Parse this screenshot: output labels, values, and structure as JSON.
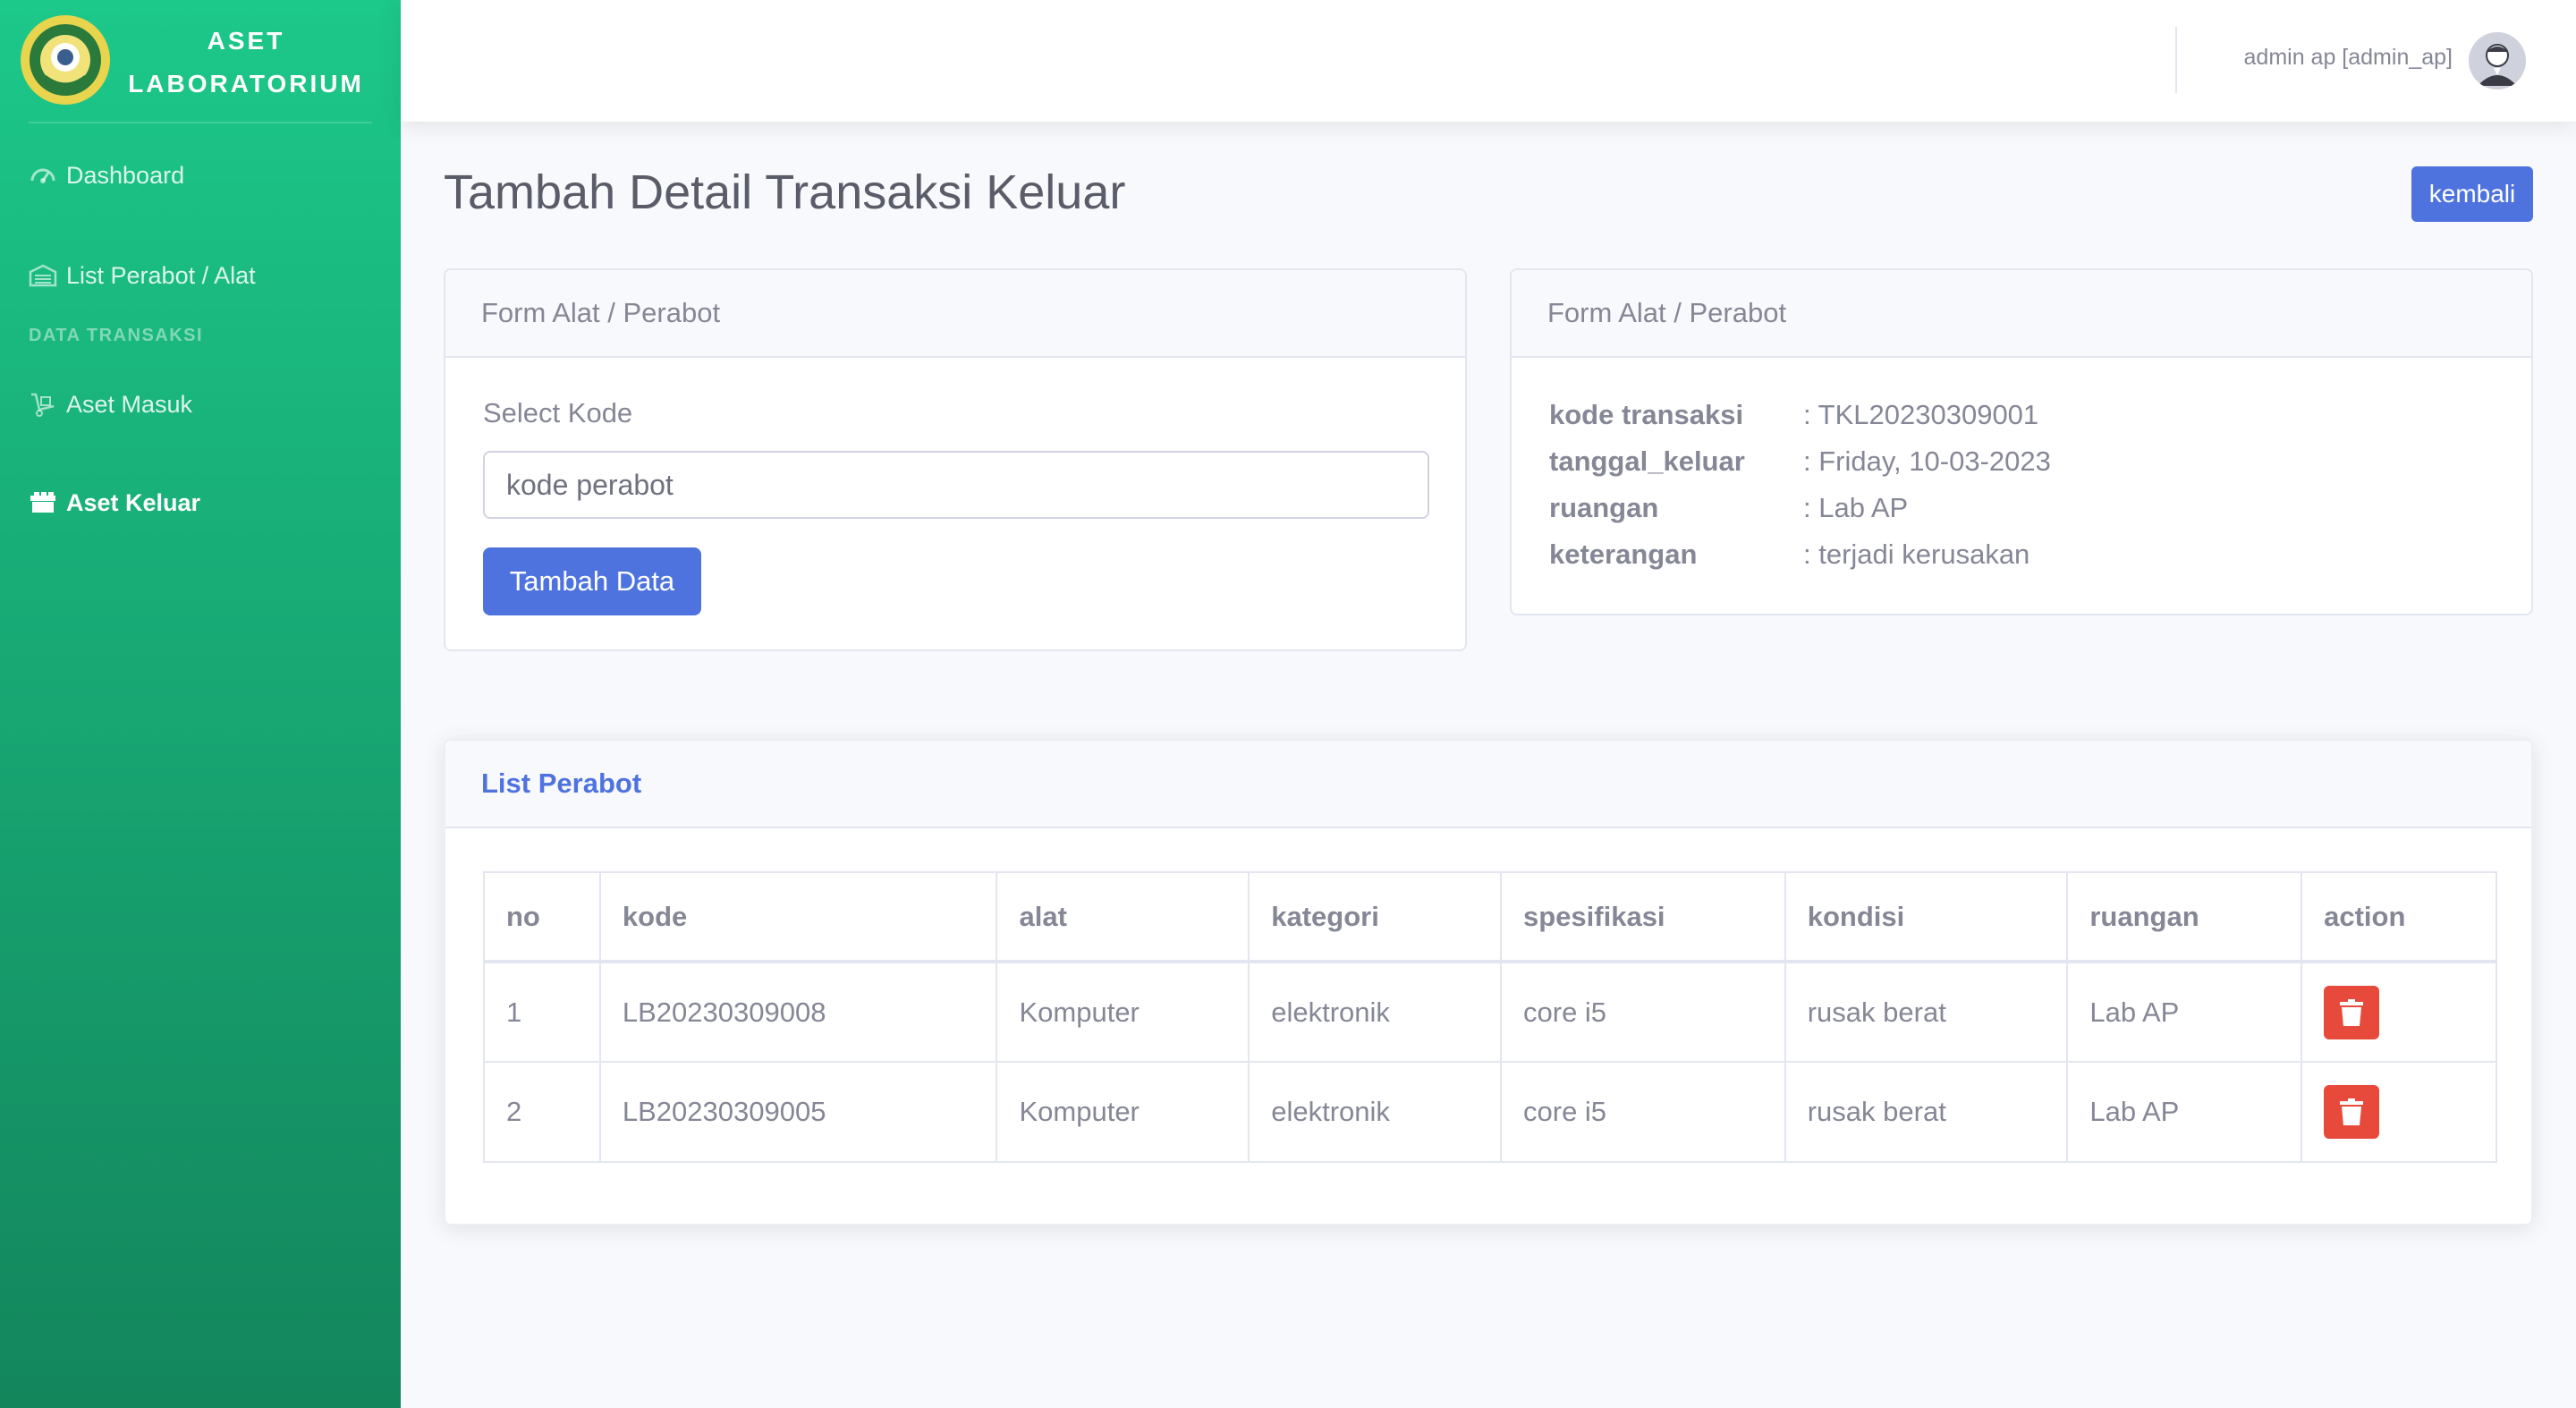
{
  "brand": {
    "line1": "ASET",
    "line2": "LABORATORIUM",
    "logo_icon": "school-emblem-icon"
  },
  "sidebar": {
    "items": [
      {
        "label": "Dashboard",
        "icon": "tachometer-icon"
      },
      {
        "label": "List Perabot / Alat",
        "icon": "warehouse-icon"
      },
      {
        "label": "Aset Masuk",
        "icon": "dolly-icon"
      },
      {
        "label": "Aset Keluar",
        "icon": "boxes-icon",
        "active": true
      }
    ],
    "heading": "DATA TRANSAKSI"
  },
  "topbar": {
    "user": "admin ap [admin_ap]",
    "avatar_icon": "user-avatar-icon"
  },
  "page": {
    "title": "Tambah Detail Transaksi Keluar",
    "back_label": "kembali"
  },
  "form_card": {
    "header": "Form Alat / Perabot",
    "select_label": "Select Kode",
    "input_placeholder": "kode perabot",
    "submit_label": "Tambah Data"
  },
  "info_card": {
    "header": "Form Alat / Perabot",
    "rows": [
      {
        "key": "kode transaksi",
        "value": ": TKL20230309001"
      },
      {
        "key": "tanggal_keluar",
        "value": ": Friday, 10-03-2023"
      },
      {
        "key": "ruangan",
        "value": ": Lab AP"
      },
      {
        "key": "keterangan",
        "value": ": terjadi kerusakan"
      }
    ]
  },
  "list_card": {
    "header": "List Perabot",
    "columns": [
      "no",
      "kode",
      "alat",
      "kategori",
      "spesifikasi",
      "kondisi",
      "ruangan",
      "action"
    ],
    "rows": [
      [
        "1",
        "LB20230309008",
        "Komputer",
        "elektronik",
        "core i5",
        "rusak berat",
        "Lab AP"
      ],
      [
        "2",
        "LB20230309005",
        "Komputer",
        "elektronik",
        "core i5",
        "rusak berat",
        "Lab AP"
      ]
    ],
    "action_icon": "trash-icon"
  },
  "colors": {
    "sidebar_top": "#1cc88a",
    "sidebar_bottom": "#13855c",
    "primary": "#4e73df",
    "danger": "#e74a3b"
  }
}
